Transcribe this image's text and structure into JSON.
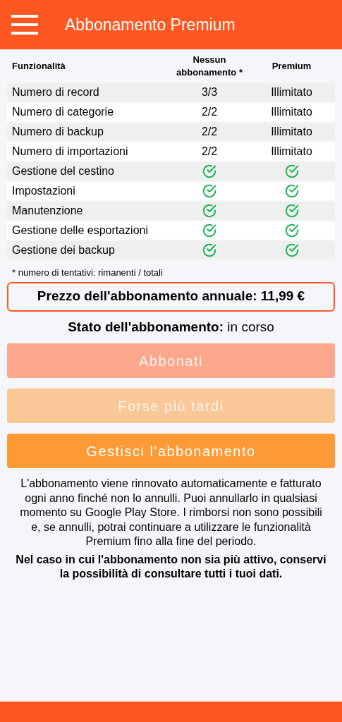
{
  "app_bar": {
    "title": "Abbonamento Premium"
  },
  "table": {
    "columns": [
      "Funzionalità",
      "Nessun abbonamento *",
      "Premium"
    ],
    "rows": [
      {
        "cells": [
          {
            "kind": "text",
            "text": "Numero di record"
          },
          {
            "kind": "text",
            "text": "3/3"
          },
          {
            "kind": "text",
            "text": "Illimitato"
          }
        ]
      },
      {
        "cells": [
          {
            "kind": "text",
            "text": "Numero di categorie"
          },
          {
            "kind": "text",
            "text": "2/2"
          },
          {
            "kind": "text",
            "text": "Illimitato"
          }
        ]
      },
      {
        "cells": [
          {
            "kind": "text",
            "text": "Numero di backup"
          },
          {
            "kind": "text",
            "text": "2/2"
          },
          {
            "kind": "text",
            "text": "Illimitato"
          }
        ]
      },
      {
        "cells": [
          {
            "kind": "text",
            "text": "Numero di importazioni"
          },
          {
            "kind": "text",
            "text": "2/2"
          },
          {
            "kind": "text",
            "text": "Illimitato"
          }
        ]
      },
      {
        "cells": [
          {
            "kind": "text",
            "text": "Gestione del cestino"
          },
          {
            "kind": "check"
          },
          {
            "kind": "check"
          }
        ]
      },
      {
        "cells": [
          {
            "kind": "text",
            "text": "Impostazioni"
          },
          {
            "kind": "check"
          },
          {
            "kind": "check"
          }
        ]
      },
      {
        "cells": [
          {
            "kind": "text",
            "text": "Manutenzione"
          },
          {
            "kind": "check"
          },
          {
            "kind": "check"
          }
        ]
      },
      {
        "cells": [
          {
            "kind": "text",
            "text": "Gestione delle esportazioni"
          },
          {
            "kind": "check"
          },
          {
            "kind": "check"
          }
        ]
      },
      {
        "cells": [
          {
            "kind": "text",
            "text": "Gestione dei backup"
          },
          {
            "kind": "check"
          },
          {
            "kind": "check"
          }
        ]
      }
    ]
  },
  "footnote": "* numero di tentativi: rimanenti / totali",
  "price": "Prezzo dell'abbonamento annuale: 11,99 €",
  "status": "**Stato dell'abbonamento:** in corso",
  "buttons": [
    {
      "label": "Abbonati",
      "color": "#fba78b",
      "disabled": true
    },
    {
      "label": "Forse più tardi",
      "color": "#f9c896",
      "disabled": true
    },
    {
      "label": "Gestisci l'abbonamento",
      "color": "#fe9a35",
      "disabled": false
    }
  ],
  "info": "L'abbonamento viene rinnovato automaticamente e fatturato ogni anno finché non lo annulli. Puoi annullarlo in qualsiasi momento su Google Play Store. I rimborsi non sono possibili e, se annulli, potrai continuare a utilizzare le funzionalità Premium fino alla fine del periodo.",
  "note": "Nel caso in cui l'abbonamento non sia più attivo, conservi la possibilità di consultare tutti i tuoi dati."
}
